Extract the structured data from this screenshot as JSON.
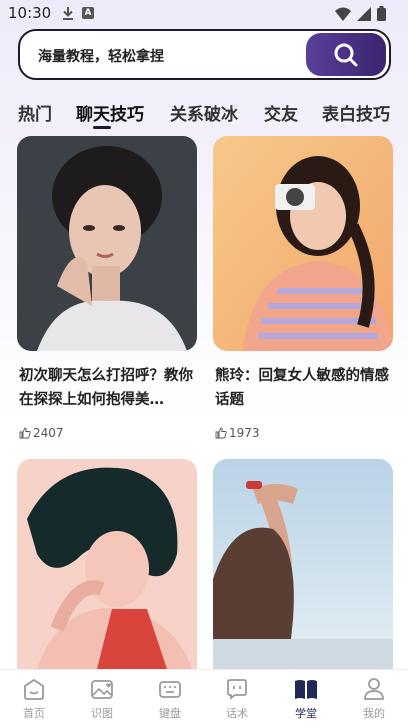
{
  "status_bar": {
    "time": "10:30",
    "badge": "A"
  },
  "search": {
    "placeholder": "海量教程，轻松拿捏"
  },
  "tabs": [
    {
      "label": "热门"
    },
    {
      "label": "聊天技巧",
      "active": true
    },
    {
      "label": "关系破冰"
    },
    {
      "label": "交友"
    },
    {
      "label": "表白技巧"
    }
  ],
  "cards": [
    {
      "title": "初次聊天怎么打招呼？教你在探探上如何抱得美…",
      "likes": "2407"
    },
    {
      "title": "熊玲：回复女人敏感的情感话题",
      "likes": "1973"
    },
    {
      "title": "",
      "likes": ""
    },
    {
      "title": "",
      "likes": ""
    }
  ],
  "bottom_nav": [
    {
      "label": "首页",
      "icon": "home-icon"
    },
    {
      "label": "识图",
      "icon": "image-heart-icon"
    },
    {
      "label": "键盘",
      "icon": "keyboard-icon"
    },
    {
      "label": "话术",
      "icon": "chat-icon"
    },
    {
      "label": "学堂",
      "icon": "book-icon",
      "active": true
    },
    {
      "label": "我的",
      "icon": "profile-icon"
    }
  ],
  "colors": {
    "accent": "#3b2470",
    "nav_active": "#1e2a55",
    "nav_inactive": "#9a9a9a"
  }
}
